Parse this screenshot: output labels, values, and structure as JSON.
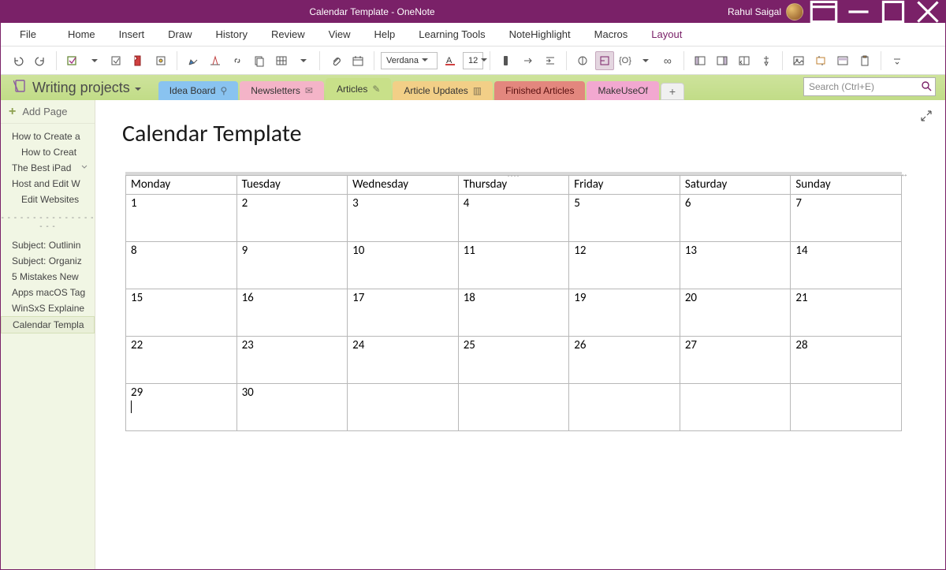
{
  "titlebar": {
    "title": "Calendar Template  -  OneNote",
    "user": "Rahul Saigal"
  },
  "menubar": {
    "items": [
      "File",
      "Home",
      "Insert",
      "Draw",
      "History",
      "Review",
      "View",
      "Help",
      "Learning Tools",
      "NoteHighlight",
      "Macros",
      "Layout"
    ],
    "active": "Layout"
  },
  "ribbon": {
    "font_name": "Verdana",
    "font_size": "12"
  },
  "notebook": {
    "name": "Writing projects"
  },
  "section_tabs": [
    {
      "label": "Idea Board",
      "class": "stab-ideaboard",
      "icon": "anchor"
    },
    {
      "label": "Newsletters",
      "class": "stab-newsletters",
      "icon": "mail"
    },
    {
      "label": "Articles",
      "class": "stab-articles",
      "icon": "pen",
      "active": true
    },
    {
      "label": "Article Updates",
      "class": "stab-updates",
      "icon": "board"
    },
    {
      "label": "Finished Articles",
      "class": "stab-finished",
      "icon": ""
    },
    {
      "label": "MakeUseOf",
      "class": "stab-mko",
      "icon": ""
    }
  ],
  "search": {
    "placeholder": "Search (Ctrl+E)"
  },
  "sidebar": {
    "add_page": "Add Page",
    "pages_top": [
      {
        "label": "How to Create a",
        "sub": false
      },
      {
        "label": "How to Creat",
        "sub": true
      },
      {
        "label": "The Best iPad",
        "sub": false,
        "chev": true
      },
      {
        "label": "Host and Edit W",
        "sub": false
      },
      {
        "label": "Edit Websites",
        "sub": true
      }
    ],
    "pages_bottom": [
      {
        "label": "Subject: Outlinin",
        "sub": false
      },
      {
        "label": "Subject: Organiz",
        "sub": false
      },
      {
        "label": "5 Mistakes New",
        "sub": false
      },
      {
        "label": "Apps macOS Tag",
        "sub": false
      },
      {
        "label": "WinSxS Explaine",
        "sub": false
      },
      {
        "label": "Calendar Templa",
        "sub": false,
        "selected": true
      }
    ]
  },
  "page": {
    "title": "Calendar Template",
    "calendar": {
      "days": [
        "Monday",
        "Tuesday",
        "Wednesday",
        "Thursday",
        "Friday",
        "Saturday",
        "Sunday"
      ],
      "weeks": [
        [
          "1",
          "2",
          "3",
          "4",
          "5",
          "6",
          "7"
        ],
        [
          "8",
          "9",
          "10",
          "11",
          "12",
          "13",
          "14"
        ],
        [
          "15",
          "16",
          "17",
          "18",
          "19",
          "20",
          "21"
        ],
        [
          "22",
          "23",
          "24",
          "25",
          "26",
          "27",
          "28"
        ],
        [
          "29",
          "30",
          "",
          "",
          "",
          "",
          ""
        ]
      ]
    }
  }
}
